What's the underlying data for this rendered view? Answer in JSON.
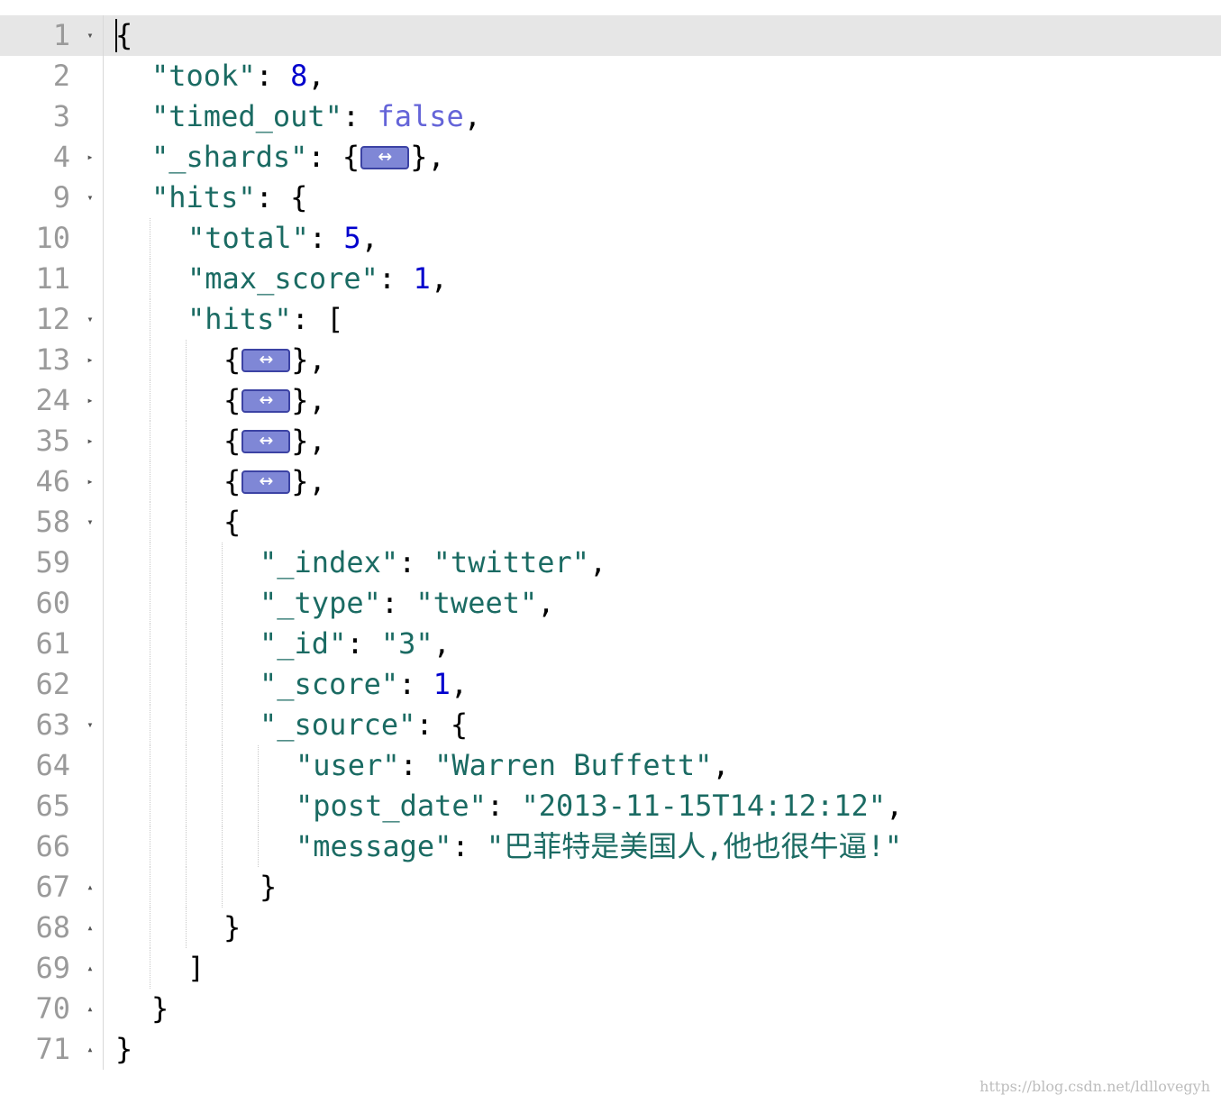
{
  "lines": [
    {
      "n": "1",
      "fold": "open",
      "indent": 0,
      "active": true,
      "tokens": [
        [
          "punc",
          "{"
        ]
      ]
    },
    {
      "n": "2",
      "fold": "none",
      "indent": 1,
      "tokens": [
        [
          "key",
          "\"took\""
        ],
        [
          "punc",
          ": "
        ],
        [
          "num",
          "8"
        ],
        [
          "punc",
          ","
        ]
      ]
    },
    {
      "n": "3",
      "fold": "none",
      "indent": 1,
      "tokens": [
        [
          "key",
          "\"timed_out\""
        ],
        [
          "punc",
          ": "
        ],
        [
          "bool",
          "false"
        ],
        [
          "punc",
          ","
        ]
      ]
    },
    {
      "n": "4",
      "fold": "closed",
      "indent": 1,
      "tokens": [
        [
          "key",
          "\"_shards\""
        ],
        [
          "punc",
          ": {"
        ],
        [
          "collapsed",
          ""
        ],
        [
          "punc",
          "},"
        ]
      ]
    },
    {
      "n": "9",
      "fold": "open",
      "indent": 1,
      "tokens": [
        [
          "key",
          "\"hits\""
        ],
        [
          "punc",
          ": {"
        ]
      ]
    },
    {
      "n": "10",
      "fold": "none",
      "indent": 2,
      "tokens": [
        [
          "key",
          "\"total\""
        ],
        [
          "punc",
          ": "
        ],
        [
          "num",
          "5"
        ],
        [
          "punc",
          ","
        ]
      ]
    },
    {
      "n": "11",
      "fold": "none",
      "indent": 2,
      "tokens": [
        [
          "key",
          "\"max_score\""
        ],
        [
          "punc",
          ": "
        ],
        [
          "num",
          "1"
        ],
        [
          "punc",
          ","
        ]
      ]
    },
    {
      "n": "12",
      "fold": "open",
      "indent": 2,
      "tokens": [
        [
          "key",
          "\"hits\""
        ],
        [
          "punc",
          ": ["
        ]
      ]
    },
    {
      "n": "13",
      "fold": "closed",
      "indent": 3,
      "tokens": [
        [
          "punc",
          "{"
        ],
        [
          "collapsed",
          ""
        ],
        [
          "punc",
          "},"
        ]
      ]
    },
    {
      "n": "24",
      "fold": "closed",
      "indent": 3,
      "tokens": [
        [
          "punc",
          "{"
        ],
        [
          "collapsed",
          ""
        ],
        [
          "punc",
          "},"
        ]
      ]
    },
    {
      "n": "35",
      "fold": "closed",
      "indent": 3,
      "tokens": [
        [
          "punc",
          "{"
        ],
        [
          "collapsed",
          ""
        ],
        [
          "punc",
          "},"
        ]
      ]
    },
    {
      "n": "46",
      "fold": "closed",
      "indent": 3,
      "tokens": [
        [
          "punc",
          "{"
        ],
        [
          "collapsed",
          ""
        ],
        [
          "punc",
          "},"
        ]
      ]
    },
    {
      "n": "58",
      "fold": "open",
      "indent": 3,
      "tokens": [
        [
          "punc",
          "{"
        ]
      ]
    },
    {
      "n": "59",
      "fold": "none",
      "indent": 4,
      "tokens": [
        [
          "key",
          "\"_index\""
        ],
        [
          "punc",
          ": "
        ],
        [
          "str",
          "\"twitter\""
        ],
        [
          "punc",
          ","
        ]
      ]
    },
    {
      "n": "60",
      "fold": "none",
      "indent": 4,
      "tokens": [
        [
          "key",
          "\"_type\""
        ],
        [
          "punc",
          ": "
        ],
        [
          "str",
          "\"tweet\""
        ],
        [
          "punc",
          ","
        ]
      ]
    },
    {
      "n": "61",
      "fold": "none",
      "indent": 4,
      "tokens": [
        [
          "key",
          "\"_id\""
        ],
        [
          "punc",
          ": "
        ],
        [
          "str",
          "\"3\""
        ],
        [
          "punc",
          ","
        ]
      ]
    },
    {
      "n": "62",
      "fold": "none",
      "indent": 4,
      "tokens": [
        [
          "key",
          "\"_score\""
        ],
        [
          "punc",
          ": "
        ],
        [
          "num",
          "1"
        ],
        [
          "punc",
          ","
        ]
      ]
    },
    {
      "n": "63",
      "fold": "open",
      "indent": 4,
      "tokens": [
        [
          "key",
          "\"_source\""
        ],
        [
          "punc",
          ": {"
        ]
      ]
    },
    {
      "n": "64",
      "fold": "none",
      "indent": 5,
      "tokens": [
        [
          "key",
          "\"user\""
        ],
        [
          "punc",
          ": "
        ],
        [
          "str",
          "\"Warren Buffett\""
        ],
        [
          "punc",
          ","
        ]
      ]
    },
    {
      "n": "65",
      "fold": "none",
      "indent": 5,
      "tokens": [
        [
          "key",
          "\"post_date\""
        ],
        [
          "punc",
          ": "
        ],
        [
          "str",
          "\"2013-11-15T14:12:12\""
        ],
        [
          "punc",
          ","
        ]
      ]
    },
    {
      "n": "66",
      "fold": "none",
      "indent": 5,
      "tokens": [
        [
          "key",
          "\"message\""
        ],
        [
          "punc",
          ": "
        ],
        [
          "str",
          "\"巴菲特是美国人,他也很牛逼!\""
        ]
      ]
    },
    {
      "n": "67",
      "fold": "end",
      "indent": 4,
      "tokens": [
        [
          "punc",
          "}"
        ]
      ]
    },
    {
      "n": "68",
      "fold": "end",
      "indent": 3,
      "tokens": [
        [
          "punc",
          "}"
        ]
      ]
    },
    {
      "n": "69",
      "fold": "end",
      "indent": 2,
      "tokens": [
        [
          "punc",
          "]"
        ]
      ]
    },
    {
      "n": "70",
      "fold": "end",
      "indent": 1,
      "tokens": [
        [
          "punc",
          "}"
        ]
      ]
    },
    {
      "n": "71",
      "fold": "end",
      "indent": 0,
      "tokens": [
        [
          "punc",
          "}"
        ]
      ]
    }
  ],
  "fold_icons": {
    "open": "fold-open-icon",
    "closed": "fold-closed-icon",
    "end": "fold-end-icon"
  },
  "collapsed_icon": "collapsed-block-icon",
  "watermark": "https://blog.csdn.net/ldllovegyh",
  "colors": {
    "key": "#1b6b63",
    "string": "#1b6b63",
    "number": "#0000cd",
    "boolean": "#6464d8",
    "collapsed": "#7f87d6"
  }
}
